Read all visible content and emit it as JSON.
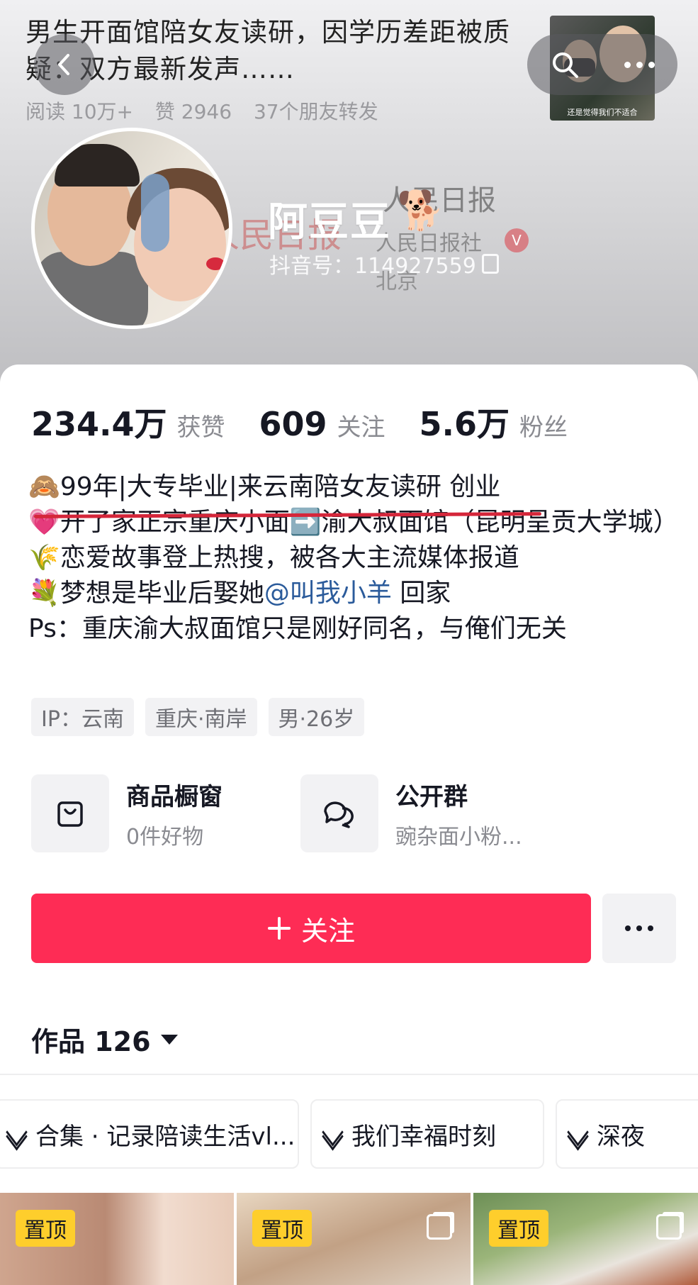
{
  "news": {
    "title": "男生开面馆陪女友读研，因学历差距被质疑：双方最新发声……",
    "reads": "阅读 10万+",
    "likes": "赞 2946",
    "shares": "37个朋友转发",
    "thumb_caption": "还是觉得我们不适合"
  },
  "background_overlay": {
    "account_name": "人民日报",
    "org": "人民日报社",
    "city": "北京",
    "logo_text": "人民日报"
  },
  "profile": {
    "nickname": "阿豆豆",
    "nickname_emoji": "🐕",
    "douyin_id": "抖音号：114927559"
  },
  "stats": [
    {
      "value": "234.4万",
      "label": "获赞"
    },
    {
      "value": "609",
      "label": "关注"
    },
    {
      "value": "5.6万",
      "label": "粉丝"
    }
  ],
  "bio": {
    "line1": "🙈99年|大专毕业|来云南陪女友读研 创业",
    "line2": "💗开了家正宗重庆小面➡️渝大叔面馆（昆明呈贡大学城）",
    "line3": "🌾恋爱故事登上热搜，被各大主流媒体报道",
    "line4_prefix": "💐梦想是毕业后娶她",
    "line4_mention": "@叫我小羊",
    "line4_suffix": " 回家",
    "line5": "Ps：重庆渝大叔面馆只是刚好同名，与俺们无关"
  },
  "tags": [
    "IP：云南",
    "重庆·南岸",
    "男·26岁"
  ],
  "entries": [
    {
      "title": "商品橱窗",
      "subtitle": "0件好物",
      "icon": "shopping-bag-icon"
    },
    {
      "title": "公开群",
      "subtitle": "豌杂面小粉...",
      "icon": "chat-bubbles-icon"
    }
  ],
  "follow_label": "关注",
  "works_label": "作品 126",
  "collections": [
    "合集 · 记录陪读生活vl...",
    "我们幸福时刻",
    "深夜"
  ],
  "videos": [
    {
      "badge": "置顶"
    },
    {
      "badge": "置顶"
    },
    {
      "badge": "置顶"
    }
  ],
  "colors": {
    "accent": "#fe2c55",
    "pin_badge": "#fece2c",
    "mention": "#2b5b9b",
    "underline": "#d5263a"
  }
}
